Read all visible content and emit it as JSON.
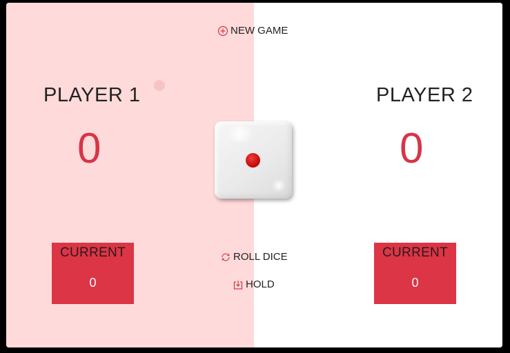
{
  "controls": {
    "new_game_label": "NEW GAME",
    "roll_dice_label": "ROLL DICE",
    "hold_label": "HOLD"
  },
  "players": [
    {
      "name": "PLAYER 1",
      "score": "0",
      "current_label": "CURRENT",
      "current_score": "0",
      "active": true
    },
    {
      "name": "PLAYER 2",
      "score": "0",
      "current_label": "CURRENT",
      "current_score": "0",
      "active": false
    }
  ],
  "dice": {
    "value": 1,
    "pip_color": "#d31515"
  },
  "colors": {
    "active_panel": "#ffdada",
    "inactive_panel": "#ffffff",
    "accent": "#dc3545",
    "score_text": "#d63547"
  },
  "icons": {
    "new_game": "plus-circle-icon",
    "roll_dice": "refresh-icon",
    "hold": "download-icon"
  }
}
